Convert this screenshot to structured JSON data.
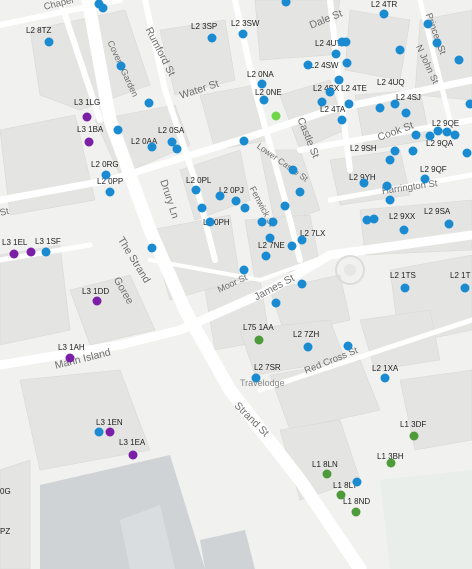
{
  "colors": {
    "blue": "#1a8bd0",
    "purple": "#7a1fa6",
    "green": "#4f9a3a",
    "light_green": "#6fd64a",
    "land": "#f1f1ef",
    "water": "#cfd3d6"
  },
  "streets": [
    "Rumford St",
    "Water St",
    "Covent Garden",
    "Dale St",
    "Princes St",
    "N John St",
    "Cook St",
    "Castle St",
    "Lower Castle St",
    "Fenwick St",
    "Drury Ln",
    "Harrington St",
    "James St",
    "Moor St",
    "The Strand",
    "Goree",
    "Mann Island",
    "Red Cross St",
    "Strand St",
    "Chapel",
    "St"
  ],
  "poi": {
    "travelodge": "Travelodge"
  },
  "postcodes": [
    {
      "label": "L2 8TZ",
      "color": "blue"
    },
    {
      "label": "L2 3SP",
      "color": "blue"
    },
    {
      "label": "L2 3SW",
      "color": "blue"
    },
    {
      "label": "L2 4TR",
      "color": "blue"
    },
    {
      "label": "L2 4UT",
      "color": "blue"
    },
    {
      "label": "L2 4SW",
      "color": "blue"
    },
    {
      "label": "L2 0NA",
      "color": "blue"
    },
    {
      "label": "L2 0NE",
      "color": "light_green"
    },
    {
      "label": "L2 4SX",
      "color": "blue"
    },
    {
      "label": "L2 4TE",
      "color": "blue"
    },
    {
      "label": "L2 4UQ",
      "color": "blue"
    },
    {
      "label": "L2 4SJ",
      "color": "blue"
    },
    {
      "label": "L2 4TA",
      "color": "blue"
    },
    {
      "label": "L3 1LG",
      "color": "purple"
    },
    {
      "label": "L3 1BA",
      "color": "purple"
    },
    {
      "label": "L2 0AA",
      "color": "blue"
    },
    {
      "label": "L2 0SA",
      "color": "blue"
    },
    {
      "label": "L2 9SH",
      "color": "blue"
    },
    {
      "label": "L2 9QA",
      "color": "blue"
    },
    {
      "label": "L2 9QE",
      "color": "blue"
    },
    {
      "label": "L2 0RG",
      "color": "blue"
    },
    {
      "label": "L2 0PP",
      "color": "blue"
    },
    {
      "label": "L2 0PL",
      "color": "blue"
    },
    {
      "label": "L2 0PJ",
      "color": "blue"
    },
    {
      "label": "L2 9YH",
      "color": "blue"
    },
    {
      "label": "L2 9QF",
      "color": "blue"
    },
    {
      "label": "L2 0PH",
      "color": "blue"
    },
    {
      "label": "L2 9XX",
      "color": "blue"
    },
    {
      "label": "L2 9SA",
      "color": "blue"
    },
    {
      "label": "L3 1EL",
      "color": "purple"
    },
    {
      "label": "L3 1SF",
      "color": "purple"
    },
    {
      "label": "L2 7LX",
      "color": "blue"
    },
    {
      "label": "L2 7NE",
      "color": "blue"
    },
    {
      "label": "L2 1TS",
      "color": "blue"
    },
    {
      "label": "L2 1T",
      "color": "blue"
    },
    {
      "label": "L3 1DD",
      "color": "purple"
    },
    {
      "label": "L75 1AA",
      "color": "green"
    },
    {
      "label": "L2 7ZH",
      "color": "blue"
    },
    {
      "label": "L3 1AH",
      "color": "purple"
    },
    {
      "label": "L2 7SR",
      "color": "blue"
    },
    {
      "label": "L2 1XA",
      "color": "blue"
    },
    {
      "label": "L3 1EN",
      "color": "purple"
    },
    {
      "label": "L3 1EA",
      "color": "purple"
    },
    {
      "label": "L1 3DF",
      "color": "green"
    },
    {
      "label": "L1 8LN",
      "color": "green"
    },
    {
      "label": "L1 3BH",
      "color": "green"
    },
    {
      "label": "L1 8LT",
      "color": "green"
    },
    {
      "label": "L1 8ND",
      "color": "green"
    },
    {
      "label": "0G",
      "color": "blue"
    },
    {
      "label": "PZ",
      "color": "blue"
    }
  ]
}
